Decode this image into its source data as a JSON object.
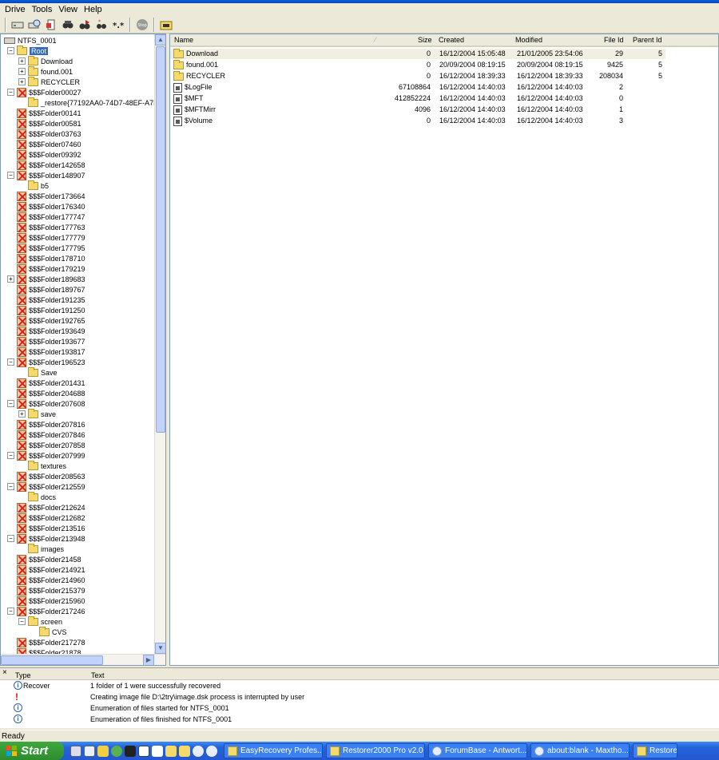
{
  "menu": [
    "Drive",
    "Tools",
    "View",
    "Help"
  ],
  "toolbar_icons": [
    "drive-icon",
    "drive-scan-icon",
    "recover-icon",
    "find-icon",
    "find-next-icon",
    "filter-icon",
    "options-icon",
    "stop-icon",
    "folder-icon"
  ],
  "tree": {
    "drive": "NTFS_0001",
    "root": "Root",
    "nodes": [
      {
        "label": "Download",
        "icon": "folder",
        "expander": "+",
        "indent": 2
      },
      {
        "label": "found.001",
        "icon": "folder",
        "expander": "+",
        "indent": 2
      },
      {
        "label": "RECYCLER",
        "icon": "folder",
        "expander": "+",
        "indent": 2
      },
      {
        "label": "$$$Folder00027",
        "icon": "x",
        "expander": "−",
        "indent": 1
      },
      {
        "label": "_restore{77192AA0-74D7-48EF-A7D",
        "icon": "folder",
        "expander": "",
        "indent": 2
      },
      {
        "label": "$$$Folder00141",
        "icon": "x",
        "expander": "",
        "indent": 1
      },
      {
        "label": "$$$Folder00581",
        "icon": "x",
        "expander": "",
        "indent": 1
      },
      {
        "label": "$$$Folder03763",
        "icon": "x",
        "expander": "",
        "indent": 1
      },
      {
        "label": "$$$Folder07460",
        "icon": "x",
        "expander": "",
        "indent": 1
      },
      {
        "label": "$$$Folder09392",
        "icon": "x",
        "expander": "",
        "indent": 1
      },
      {
        "label": "$$$Folder142658",
        "icon": "x",
        "expander": "",
        "indent": 1
      },
      {
        "label": "$$$Folder148907",
        "icon": "x",
        "expander": "−",
        "indent": 1
      },
      {
        "label": "b5",
        "icon": "folder",
        "expander": "",
        "indent": 2
      },
      {
        "label": "$$$Folder173664",
        "icon": "x",
        "expander": "",
        "indent": 1
      },
      {
        "label": "$$$Folder176340",
        "icon": "x",
        "expander": "",
        "indent": 1
      },
      {
        "label": "$$$Folder177747",
        "icon": "x",
        "expander": "",
        "indent": 1
      },
      {
        "label": "$$$Folder177763",
        "icon": "x",
        "expander": "",
        "indent": 1
      },
      {
        "label": "$$$Folder177779",
        "icon": "x",
        "expander": "",
        "indent": 1
      },
      {
        "label": "$$$Folder177795",
        "icon": "x",
        "expander": "",
        "indent": 1
      },
      {
        "label": "$$$Folder178710",
        "icon": "x",
        "expander": "",
        "indent": 1
      },
      {
        "label": "$$$Folder179219",
        "icon": "x",
        "expander": "",
        "indent": 1
      },
      {
        "label": "$$$Folder189683",
        "icon": "x",
        "expander": "+",
        "indent": 1
      },
      {
        "label": "$$$Folder189767",
        "icon": "x",
        "expander": "",
        "indent": 1
      },
      {
        "label": "$$$Folder191235",
        "icon": "x",
        "expander": "",
        "indent": 1
      },
      {
        "label": "$$$Folder191250",
        "icon": "x",
        "expander": "",
        "indent": 1
      },
      {
        "label": "$$$Folder192765",
        "icon": "x",
        "expander": "",
        "indent": 1
      },
      {
        "label": "$$$Folder193649",
        "icon": "x",
        "expander": "",
        "indent": 1
      },
      {
        "label": "$$$Folder193677",
        "icon": "x",
        "expander": "",
        "indent": 1
      },
      {
        "label": "$$$Folder193817",
        "icon": "x",
        "expander": "",
        "indent": 1
      },
      {
        "label": "$$$Folder196523",
        "icon": "x",
        "expander": "−",
        "indent": 1
      },
      {
        "label": "Save",
        "icon": "folder",
        "expander": "",
        "indent": 2
      },
      {
        "label": "$$$Folder201431",
        "icon": "x",
        "expander": "",
        "indent": 1
      },
      {
        "label": "$$$Folder204688",
        "icon": "x",
        "expander": "",
        "indent": 1
      },
      {
        "label": "$$$Folder207608",
        "icon": "x",
        "expander": "−",
        "indent": 1
      },
      {
        "label": "save",
        "icon": "folder",
        "expander": "+",
        "indent": 2
      },
      {
        "label": "$$$Folder207816",
        "icon": "x",
        "expander": "",
        "indent": 1
      },
      {
        "label": "$$$Folder207846",
        "icon": "x",
        "expander": "",
        "indent": 1
      },
      {
        "label": "$$$Folder207858",
        "icon": "x",
        "expander": "",
        "indent": 1
      },
      {
        "label": "$$$Folder207999",
        "icon": "x",
        "expander": "−",
        "indent": 1
      },
      {
        "label": "textures",
        "icon": "folder",
        "expander": "",
        "indent": 2
      },
      {
        "label": "$$$Folder208563",
        "icon": "x",
        "expander": "",
        "indent": 1
      },
      {
        "label": "$$$Folder212559",
        "icon": "x",
        "expander": "−",
        "indent": 1
      },
      {
        "label": "docs",
        "icon": "folder",
        "expander": "",
        "indent": 2
      },
      {
        "label": "$$$Folder212624",
        "icon": "x",
        "expander": "",
        "indent": 1
      },
      {
        "label": "$$$Folder212682",
        "icon": "x",
        "expander": "",
        "indent": 1
      },
      {
        "label": "$$$Folder213516",
        "icon": "x",
        "expander": "",
        "indent": 1
      },
      {
        "label": "$$$Folder213948",
        "icon": "x",
        "expander": "−",
        "indent": 1
      },
      {
        "label": "images",
        "icon": "folder",
        "expander": "",
        "indent": 2
      },
      {
        "label": "$$$Folder21458",
        "icon": "x",
        "expander": "",
        "indent": 1
      },
      {
        "label": "$$$Folder214921",
        "icon": "x",
        "expander": "",
        "indent": 1
      },
      {
        "label": "$$$Folder214960",
        "icon": "x",
        "expander": "",
        "indent": 1
      },
      {
        "label": "$$$Folder215379",
        "icon": "x",
        "expander": "",
        "indent": 1
      },
      {
        "label": "$$$Folder215960",
        "icon": "x",
        "expander": "",
        "indent": 1
      },
      {
        "label": "$$$Folder217246",
        "icon": "x",
        "expander": "−",
        "indent": 1
      },
      {
        "label": "screen",
        "icon": "folder",
        "expander": "−",
        "indent": 2
      },
      {
        "label": "CVS",
        "icon": "folder",
        "expander": "",
        "indent": 3
      },
      {
        "label": "$$$Folder217278",
        "icon": "x",
        "expander": "",
        "indent": 1
      },
      {
        "label": "$$$Folder21878",
        "icon": "x",
        "expander": "",
        "indent": 1
      }
    ]
  },
  "list": {
    "columns": [
      "Name",
      "Size",
      "Created",
      "Modified",
      "File Id",
      "Parent Id"
    ],
    "rows": [
      {
        "name": "Download",
        "icon": "folder",
        "size": "0",
        "created": "16/12/2004 15:05:48",
        "modified": "21/01/2005 23:54:06",
        "file_id": "29",
        "parent_id": "5",
        "selected": true
      },
      {
        "name": "found.001",
        "icon": "folder",
        "size": "0",
        "created": "20/09/2004 08:19:15",
        "modified": "20/09/2004 08:19:15",
        "file_id": "9425",
        "parent_id": "5",
        "selected": false
      },
      {
        "name": "RECYCLER",
        "icon": "folder",
        "size": "0",
        "created": "16/12/2004 18:39:33",
        "modified": "16/12/2004 18:39:33",
        "file_id": "208034",
        "parent_id": "5",
        "selected": false
      },
      {
        "name": "$LogFile",
        "icon": "file",
        "size": "67108864",
        "created": "16/12/2004 14:40:03",
        "modified": "16/12/2004 14:40:03",
        "file_id": "2",
        "parent_id": "",
        "selected": false
      },
      {
        "name": "$MFT",
        "icon": "file",
        "size": "412852224",
        "created": "16/12/2004 14:40:03",
        "modified": "16/12/2004 14:40:03",
        "file_id": "0",
        "parent_id": "",
        "selected": false
      },
      {
        "name": "$MFTMirr",
        "icon": "file",
        "size": "4096",
        "created": "16/12/2004 14:40:03",
        "modified": "16/12/2004 14:40:03",
        "file_id": "1",
        "parent_id": "",
        "selected": false
      },
      {
        "name": "$Volume",
        "icon": "file",
        "size": "0",
        "created": "16/12/2004 14:40:03",
        "modified": "16/12/2004 14:40:03",
        "file_id": "3",
        "parent_id": "",
        "selected": false
      }
    ]
  },
  "log": {
    "close_glyph": "×",
    "columns": [
      "Type",
      "Text"
    ],
    "rows": [
      {
        "icon": "info",
        "type": "Recover",
        "text": "1 folder of 1 were successfully recovered"
      },
      {
        "icon": "warning",
        "type": "",
        "text": "Creating image file D:\\2try\\image.dsk process is interrupted by user"
      },
      {
        "icon": "info",
        "type": "",
        "text": "Enumeration of files started for NTFS_0001"
      },
      {
        "icon": "info",
        "type": "",
        "text": "Enumeration of files finished for NTFS_0001"
      }
    ]
  },
  "status": "Ready",
  "taskbar": {
    "start": "Start",
    "buttons": [
      {
        "label": "EasyRecovery Profes...",
        "icon": "app"
      },
      {
        "label": "Restorer2000 Pro v2.0",
        "icon": "folder"
      },
      {
        "label": "ForumBase - Antwort...",
        "icon": "circle"
      },
      {
        "label": "about:blank - Maxtho...",
        "icon": "circle"
      },
      {
        "label": "Restorer",
        "icon": "folder"
      }
    ]
  }
}
